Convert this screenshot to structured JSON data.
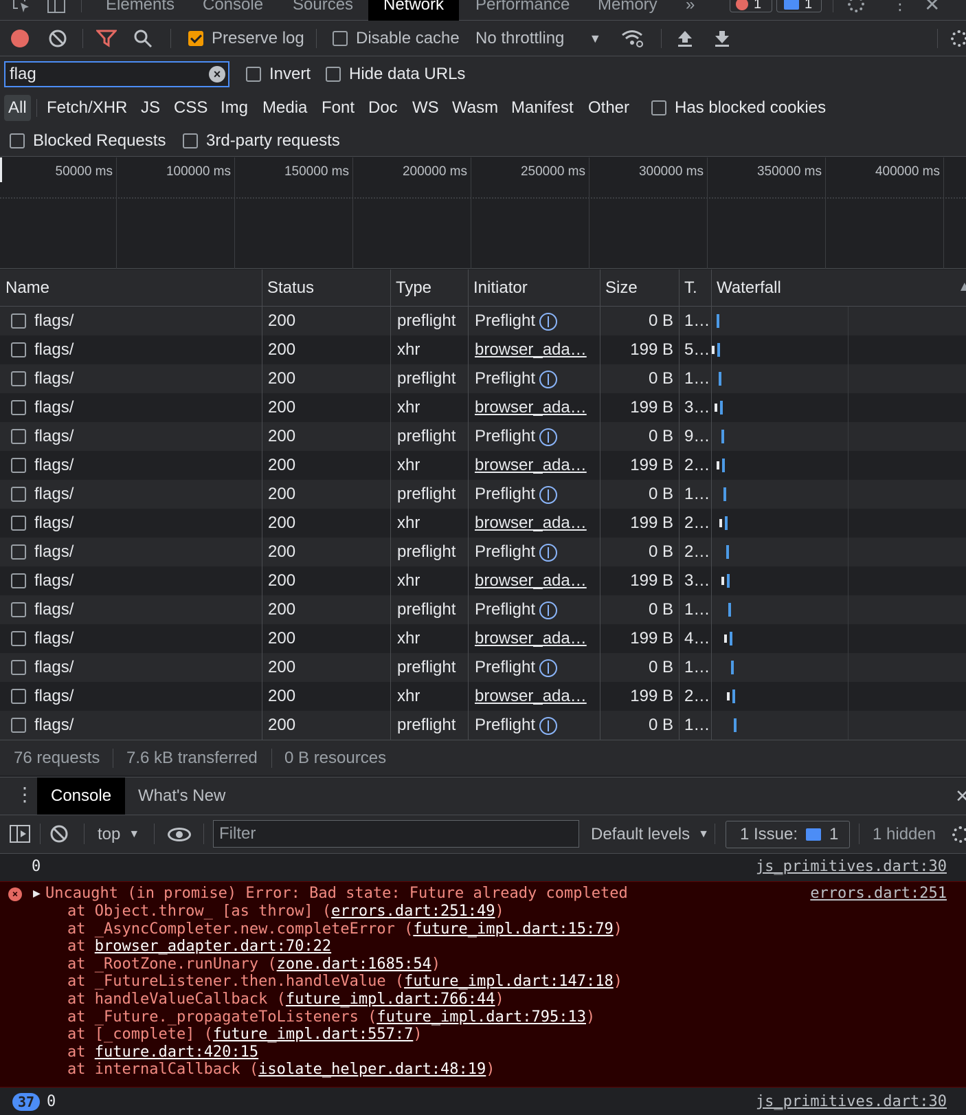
{
  "tabs": {
    "elements": "Elements",
    "console": "Console",
    "sources": "Sources",
    "network": "Network",
    "performance": "Performance",
    "memory": "Memory",
    "more": "»",
    "errors_count": "1",
    "messages_count": "1"
  },
  "toolbar": {
    "preserve_log": "Preserve log",
    "disable_cache": "Disable cache",
    "throttling": "No throttling"
  },
  "filter": {
    "value": "flag",
    "invert": "Invert",
    "hide_data_urls": "Hide data URLs",
    "types": [
      "All",
      "Fetch/XHR",
      "JS",
      "CSS",
      "Img",
      "Media",
      "Font",
      "Doc",
      "WS",
      "Wasm",
      "Manifest",
      "Other"
    ],
    "has_blocked_cookies": "Has blocked cookies",
    "blocked_requests": "Blocked Requests",
    "third_party": "3rd-party requests"
  },
  "overview": {
    "ticks": [
      "50000 ms",
      "100000 ms",
      "150000 ms",
      "200000 ms",
      "250000 ms",
      "300000 ms",
      "350000 ms",
      "400000 ms"
    ]
  },
  "table": {
    "headers": {
      "name": "Name",
      "status": "Status",
      "type": "Type",
      "initiator": "Initiator",
      "size": "Size",
      "time": "T.",
      "waterfall": "Waterfall"
    },
    "rows": [
      {
        "name": "flags/",
        "status": "200",
        "type": "preflight",
        "initiator": "Preflight",
        "size": "0 B",
        "time": "1…",
        "wf": 0.009
      },
      {
        "name": "flags/",
        "status": "200",
        "type": "xhr",
        "initiator": "browser_ada…",
        "size": "199 B",
        "time": "5…",
        "wf": 0.012
      },
      {
        "name": "flags/",
        "status": "200",
        "type": "preflight",
        "initiator": "Preflight",
        "size": "0 B",
        "time": "1…",
        "wf": 0.017
      },
      {
        "name": "flags/",
        "status": "200",
        "type": "xhr",
        "initiator": "browser_ada…",
        "size": "199 B",
        "time": "3…",
        "wf": 0.021
      },
      {
        "name": "flags/",
        "status": "200",
        "type": "preflight",
        "initiator": "Preflight",
        "size": "0 B",
        "time": "9…",
        "wf": 0.026
      },
      {
        "name": "flags/",
        "status": "200",
        "type": "xhr",
        "initiator": "browser_ada…",
        "size": "199 B",
        "time": "2…",
        "wf": 0.03
      },
      {
        "name": "flags/",
        "status": "200",
        "type": "preflight",
        "initiator": "Preflight",
        "size": "0 B",
        "time": "1…",
        "wf": 0.036
      },
      {
        "name": "flags/",
        "status": "200",
        "type": "xhr",
        "initiator": "browser_ada…",
        "size": "199 B",
        "time": "2…",
        "wf": 0.04
      },
      {
        "name": "flags/",
        "status": "200",
        "type": "preflight",
        "initiator": "Preflight",
        "size": "0 B",
        "time": "2…",
        "wf": 0.046
      },
      {
        "name": "flags/",
        "status": "200",
        "type": "xhr",
        "initiator": "browser_ada…",
        "size": "199 B",
        "time": "3…",
        "wf": 0.05
      },
      {
        "name": "flags/",
        "status": "200",
        "type": "preflight",
        "initiator": "Preflight",
        "size": "0 B",
        "time": "1…",
        "wf": 0.056
      },
      {
        "name": "flags/",
        "status": "200",
        "type": "xhr",
        "initiator": "browser_ada…",
        "size": "199 B",
        "time": "4…",
        "wf": 0.06
      },
      {
        "name": "flags/",
        "status": "200",
        "type": "preflight",
        "initiator": "Preflight",
        "size": "0 B",
        "time": "1…",
        "wf": 0.066
      },
      {
        "name": "flags/",
        "status": "200",
        "type": "xhr",
        "initiator": "browser_ada…",
        "size": "199 B",
        "time": "2…",
        "wf": 0.07
      },
      {
        "name": "flags/",
        "status": "200",
        "type": "preflight",
        "initiator": "Preflight",
        "size": "0 B",
        "time": "1…",
        "wf": 0.076
      }
    ]
  },
  "status": {
    "requests": "76 requests",
    "transferred": "7.6 kB transferred",
    "resources": "0 B resources"
  },
  "drawer": {
    "console_tab": "Console",
    "whats_new_tab": "What's New"
  },
  "console_toolbar": {
    "context": "top",
    "filter_placeholder": "Filter",
    "levels": "Default levels",
    "issues_label": "1 Issue:",
    "issues_count": "1",
    "hidden": "1 hidden"
  },
  "console": {
    "line1_value": "0",
    "line1_source": "js_primitives.dart:30",
    "error_message": "Uncaught (in promise) Error: Bad state: Future already completed",
    "error_source": "errors.dart:251",
    "stack": [
      {
        "pre": "at Object.throw_ [as throw] (",
        "link": "errors.dart:251:49",
        "post": ")"
      },
      {
        "pre": "at _AsyncCompleter.new.completeError (",
        "link": "future_impl.dart:15:79",
        "post": ")"
      },
      {
        "pre": "at ",
        "link": "browser_adapter.dart:70:22",
        "post": ""
      },
      {
        "pre": "at _RootZone.runUnary (",
        "link": "zone.dart:1685:54",
        "post": ")"
      },
      {
        "pre": "at _FutureListener.then.handleValue (",
        "link": "future_impl.dart:147:18",
        "post": ")"
      },
      {
        "pre": "at handleValueCallback (",
        "link": "future_impl.dart:766:44",
        "post": ")"
      },
      {
        "pre": "at _Future._propagateToListeners (",
        "link": "future_impl.dart:795:13",
        "post": ")"
      },
      {
        "pre": "at [_complete] (",
        "link": "future_impl.dart:557:7",
        "post": ")"
      },
      {
        "pre": "at ",
        "link": "future.dart:420:15",
        "post": ""
      },
      {
        "pre": "at internalCallback (",
        "link": "isolate_helper.dart:48:19",
        "post": ")"
      }
    ],
    "repeat_count": "37",
    "last_value": "0",
    "last_source": "js_primitives.dart:30"
  }
}
